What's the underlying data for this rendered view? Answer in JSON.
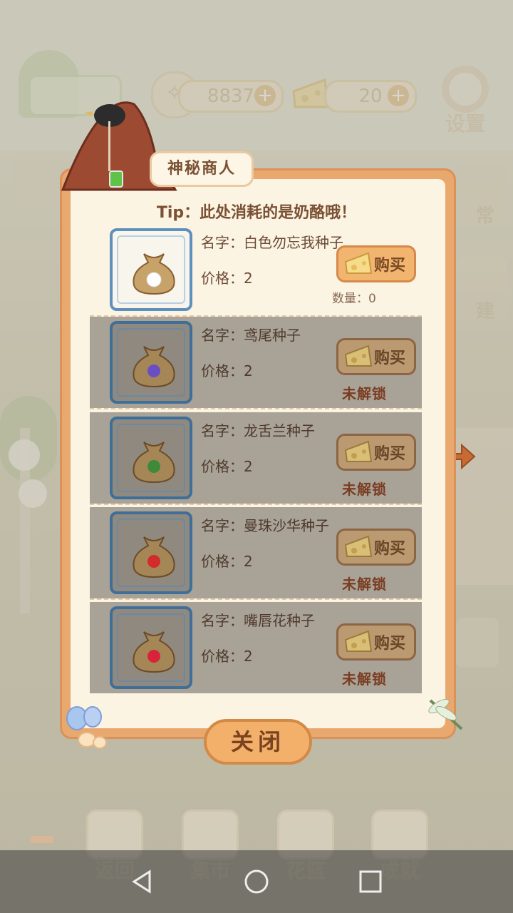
{
  "top_bar": {
    "fish_count": "8837",
    "cheese_count": "20",
    "settings_label": "设置",
    "plus": "+"
  },
  "side_labels": {
    "daily": "常",
    "build": "建"
  },
  "dialog": {
    "title": "神秘商人",
    "tip": "Tip：此处消耗的是奶酪哦！",
    "close_label": "关闭",
    "items": [
      {
        "name": "名字：白色勿忘我种子",
        "price": "价格：2",
        "buy_label": "购买",
        "quantity": "数量：0",
        "locked": false,
        "flower_color": "#ffffff"
      },
      {
        "name": "名字：鸢尾种子",
        "price": "价格：2",
        "buy_label": "购买",
        "lock_text": "未解锁",
        "locked": true,
        "flower_color": "#6a4fc4"
      },
      {
        "name": "名字：龙舌兰种子",
        "price": "价格：2",
        "buy_label": "购买",
        "lock_text": "未解锁",
        "locked": true,
        "flower_color": "#3f8a3a"
      },
      {
        "name": "名字：曼珠沙华种子",
        "price": "价格：2",
        "buy_label": "购买",
        "lock_text": "未解锁",
        "locked": true,
        "flower_color": "#d22b2b"
      },
      {
        "name": "名字：嘴唇花种子",
        "price": "价格：2",
        "buy_label": "购买",
        "lock_text": "未解锁",
        "locked": true,
        "flower_color": "#d8233a"
      }
    ]
  },
  "bottom_nav": {
    "back": "返回",
    "market": "集市",
    "flower_basket": "花篮",
    "achievement": "成就"
  },
  "colors": {
    "panel_border": "#e9a86d",
    "panel_fill": "#fbf4e3",
    "locked_row": "#a9a297",
    "text_brown": "#7a5134",
    "frame_blue": "#5e8fbd"
  }
}
